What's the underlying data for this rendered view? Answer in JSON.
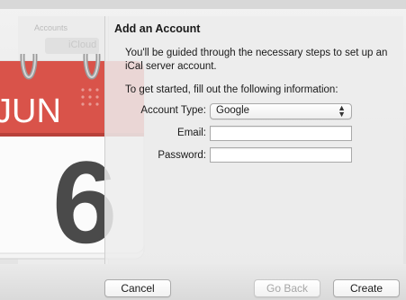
{
  "background": {
    "sidebar_label": "Accounts",
    "sidebar_item": "iCloud"
  },
  "calendar_icon": {
    "month": "JUN",
    "day": "6"
  },
  "sheet": {
    "title": "Add an Account",
    "intro": "You'll be guided through the necessary steps to set up an iCal server account.",
    "prompt": "To get started, fill out the following information:",
    "fields": {
      "account_type_label": "Account Type:",
      "account_type_value": "Google",
      "email_label": "Email:",
      "email_value": "",
      "password_label": "Password:",
      "password_value": ""
    }
  },
  "buttons": {
    "cancel": "Cancel",
    "go_back": "Go Back",
    "create": "Create"
  },
  "colors": {
    "calendar_red": "#d9534a",
    "text": "#1a1a1a",
    "disabled_text": "#a6a6a6"
  }
}
